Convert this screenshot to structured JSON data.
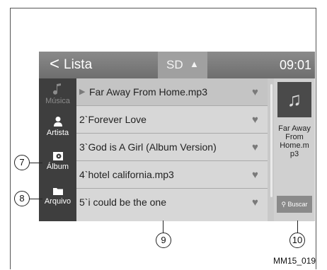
{
  "header": {
    "back_glyph": "<",
    "title": "Lista",
    "source": "SD",
    "source_arrow": "▲",
    "clock": "09:01"
  },
  "sidebar": {
    "items": [
      {
        "label": "Música",
        "icon": "music-note-icon",
        "active": false
      },
      {
        "label": "Artista",
        "icon": "person-icon",
        "active": true
      },
      {
        "label": "Álbum",
        "icon": "album-icon",
        "active": true
      },
      {
        "label": "Arquivo",
        "icon": "folder-icon",
        "active": true
      }
    ]
  },
  "list": {
    "rows": [
      {
        "text": "Far Away From Home.mp3",
        "playing": true
      },
      {
        "text": "2`Forever Love",
        "playing": false
      },
      {
        "text": "3`God is A Girl (Album Version)",
        "playing": false
      },
      {
        "text": "4`hotel california.mp3",
        "playing": false
      },
      {
        "text": "5`i could be the one",
        "playing": false
      }
    ]
  },
  "now_playing": {
    "title_lines": [
      "Far Away",
      "From",
      "Home.m",
      "p3"
    ]
  },
  "buscar_label": "Buscar",
  "callouts": {
    "c7": "7",
    "c8": "8",
    "c9": "9",
    "c10": "10"
  },
  "figure_ref": "MM15_019",
  "colors": {
    "header": "#7a7a7a",
    "sidebar": "#3e3e3e",
    "list_bg": "#d7d7d7"
  }
}
